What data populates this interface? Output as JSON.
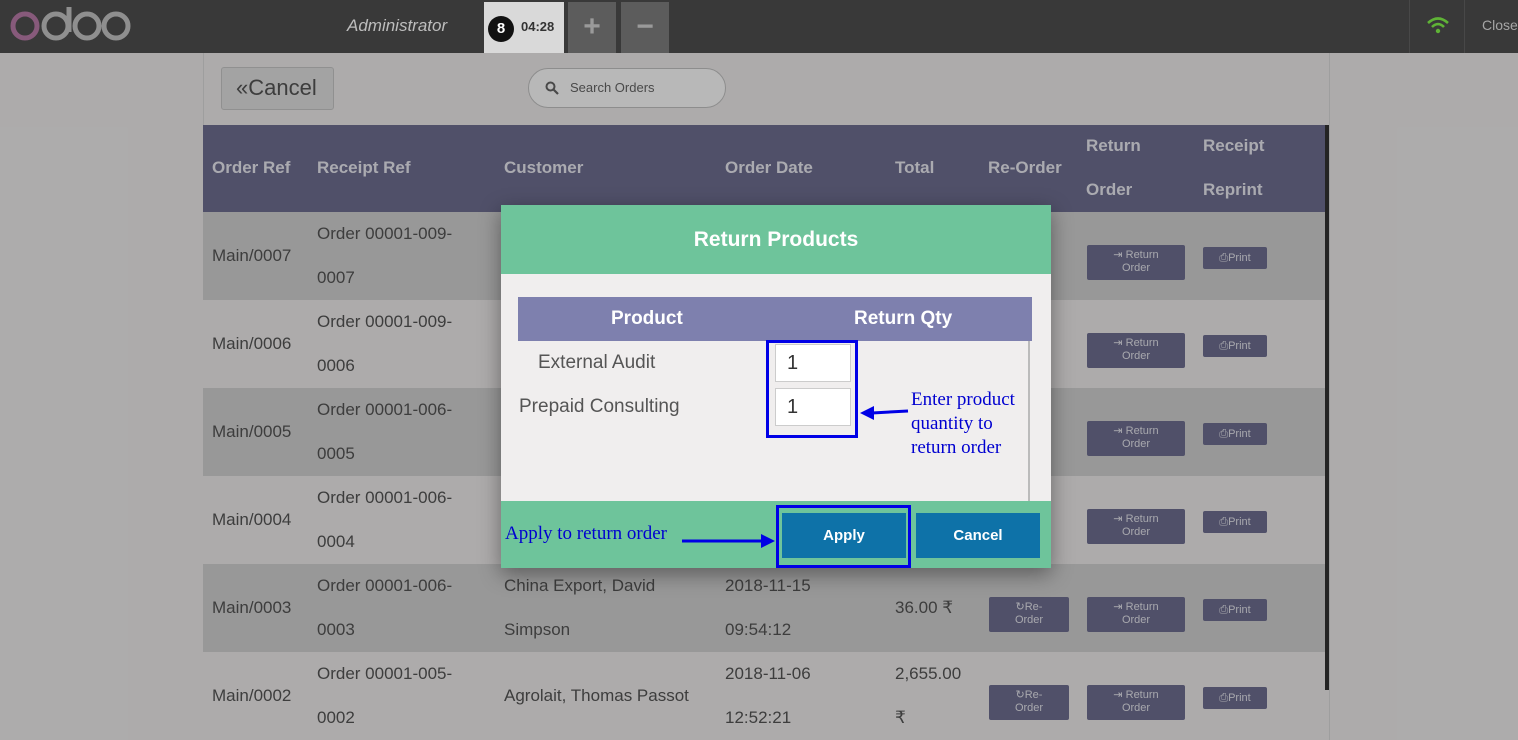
{
  "topbar": {
    "logo_text": "odoo",
    "user": "Administrator",
    "order_badge": "8",
    "order_time": "04:28",
    "add_label": "+",
    "remove_label": "−",
    "close_label": "Close"
  },
  "toolbar": {
    "cancel_label": "Cancel",
    "search_placeholder": "Search Orders"
  },
  "table": {
    "headers": {
      "order_ref": "Order Ref",
      "receipt_ref": "Receipt Ref",
      "customer": "Customer",
      "order_date": "Order Date",
      "total": "Total",
      "reorder": "Re-Order",
      "return_1": "Return",
      "return_2": "Order",
      "receipt_1": "Receipt",
      "receipt_2": "Reprint"
    },
    "rows": [
      {
        "order_ref": "Main/0007",
        "receipt_1": "Order 00001-009-",
        "receipt_2": "0007",
        "customer_1": "",
        "customer_2": "",
        "date_1": "",
        "date_2": "",
        "total_1": "",
        "total_2": ""
      },
      {
        "order_ref": "Main/0006",
        "receipt_1": "Order 00001-009-",
        "receipt_2": "0006",
        "customer_1": "",
        "customer_2": "",
        "date_1": "",
        "date_2": "",
        "total_1": "",
        "total_2": ""
      },
      {
        "order_ref": "Main/0005",
        "receipt_1": "Order 00001-006-",
        "receipt_2": "0005",
        "customer_1": "",
        "customer_2": "",
        "date_1": "",
        "date_2": "",
        "total_1": "",
        "total_2": ""
      },
      {
        "order_ref": "Main/0004",
        "receipt_1": "Order 00001-006-",
        "receipt_2": "0004",
        "customer_1": "",
        "customer_2": "",
        "date_1": "",
        "date_2": "",
        "total_1": "",
        "total_2": ""
      },
      {
        "order_ref": "Main/0003",
        "receipt_1": "Order 00001-006-",
        "receipt_2": "0003",
        "customer_1": "China Export, David",
        "customer_2": "Simpson",
        "date_1": "2018-11-15",
        "date_2": "09:54:12",
        "total_1": "36.00 ₹",
        "total_2": ""
      },
      {
        "order_ref": "Main/0002",
        "receipt_1": "Order 00001-005-",
        "receipt_2": "0002",
        "customer_1": "Agrolait, Thomas Passot",
        "customer_2": "",
        "date_1": "2018-11-06",
        "date_2": "12:52:21",
        "total_1": "2,655.00",
        "total_2": "₹"
      }
    ],
    "actions": {
      "reorder_1": "Re-",
      "reorder_2": "Order",
      "return_1": "Return",
      "return_2": "Order",
      "print": "Print"
    }
  },
  "modal": {
    "title": "Return Products",
    "col_product": "Product",
    "col_qty": "Return Qty",
    "items": [
      {
        "product": "External Audit",
        "qty": "1"
      },
      {
        "product": "Prepaid Consulting",
        "qty": "1"
      }
    ],
    "apply_label": "Apply",
    "cancel_label": "Cancel"
  },
  "annotations": {
    "qty_note_1": "Enter product",
    "qty_note_2": "quantity to",
    "qty_note_3": "return order",
    "apply_note": "Apply to return order"
  },
  "colors": {
    "topbar": "#393939",
    "table_header": "#6f7092",
    "modal_header": "#6ec49b",
    "button_primary": "#0e72a8",
    "annotation": "#0000e6",
    "wifi": "#5fb336"
  },
  "icons": [
    "wifi-icon",
    "search-icon",
    "double-chevron-left-icon",
    "refresh-icon",
    "sign-in-icon",
    "print-icon"
  ]
}
